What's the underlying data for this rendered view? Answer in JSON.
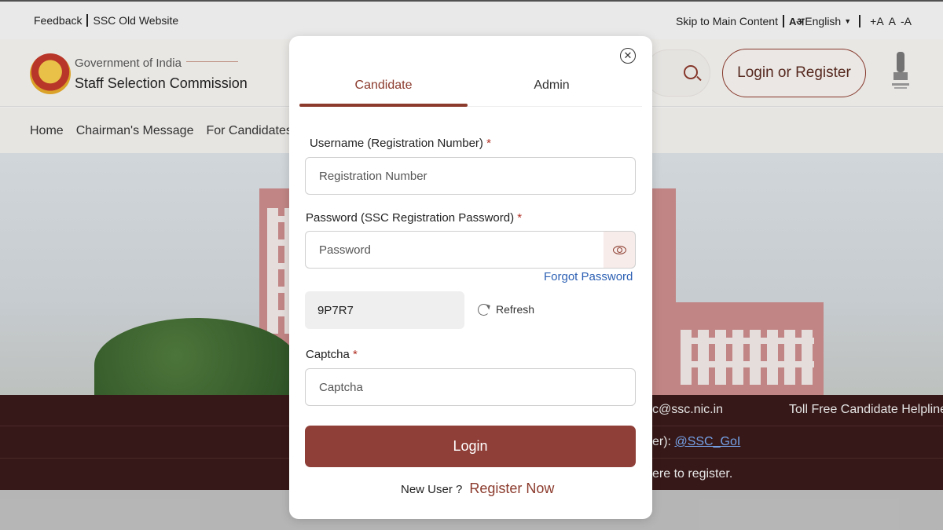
{
  "topbar": {
    "feedback": "Feedback",
    "old_website": "SSC Old Website",
    "skip": "Skip to Main Content",
    "lang_icon": "Aअ",
    "language": "English",
    "font_increase": "+A",
    "font_normal": "A",
    "font_decrease": "-A"
  },
  "header": {
    "gov": "Government of India",
    "org": "Staff Selection Commission",
    "login_register": "Login or Register"
  },
  "nav": {
    "items": [
      "Home",
      "Chairman's Message",
      "For Candidates"
    ]
  },
  "banner": {
    "email": "c@ssc.nic.in",
    "helpline": "Toll Free Candidate Helpline",
    "twitter_prefix": "er):",
    "twitter_handle": "@SSC_GoI",
    "register_text": "ere to register."
  },
  "modal": {
    "tabs": [
      "Candidate",
      "Admin"
    ],
    "active_tab": "Candidate",
    "username_label": "Username (Registration Number)",
    "username_placeholder": "Registration Number",
    "password_label": "Password (SSC Registration Password)",
    "password_placeholder": "Password",
    "forgot": "Forgot Password",
    "captcha_code": "9P7R7",
    "refresh": "Refresh",
    "captcha_label": "Captcha",
    "captcha_placeholder": "Captcha",
    "required_mark": "*",
    "login_button": "Login",
    "new_user": "New User ?",
    "register_now": "Register Now"
  },
  "colors": {
    "brand": "#8b3a2c",
    "login_button": "#8f3f38",
    "link": "#2b5fb3",
    "banner_bg": "#3a1a1a"
  }
}
